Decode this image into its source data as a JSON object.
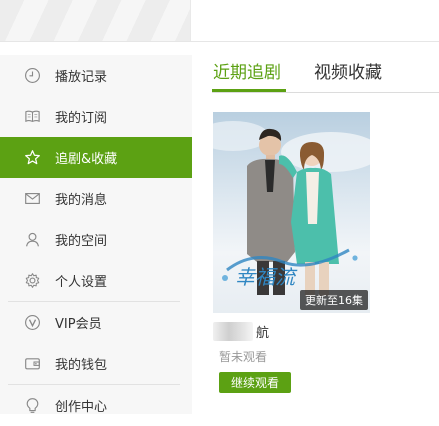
{
  "sidebar": {
    "items": [
      {
        "label": "播放记录",
        "icon": "clock-icon"
      },
      {
        "label": "我的订阅",
        "icon": "book-icon"
      },
      {
        "label": "追剧&收藏",
        "icon": "star-icon",
        "active": true
      },
      {
        "label": "我的消息",
        "icon": "envelope-icon"
      },
      {
        "label": "我的空间",
        "icon": "user-icon"
      },
      {
        "label": "个人设置",
        "icon": "gear-icon"
      },
      {
        "label": "VIP会员",
        "icon": "vip-icon"
      },
      {
        "label": "我的钱包",
        "icon": "wallet-icon"
      },
      {
        "label": "创作中心",
        "icon": "creator-icon"
      }
    ]
  },
  "tabs": [
    {
      "label": "近期追剧",
      "active": true
    },
    {
      "label": "视频收藏",
      "active": false
    }
  ],
  "card": {
    "poster_title": "幸福流",
    "badge": "更新至16集",
    "title_suffix": "航",
    "status": "暂未观看",
    "button": "继续观看"
  },
  "colors": {
    "accent": "#5ca113",
    "sidebar_bg": "#f7f7f7"
  }
}
